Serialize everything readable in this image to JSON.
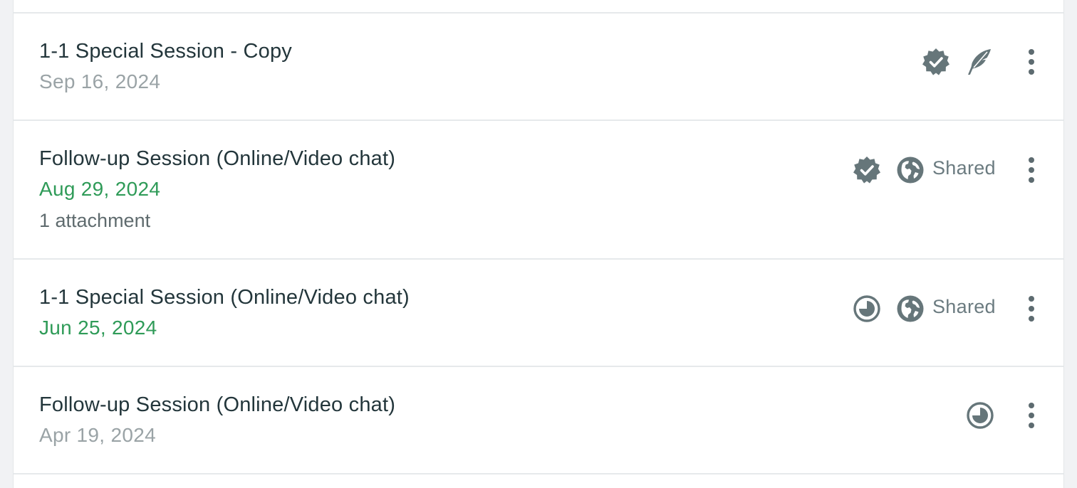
{
  "colors": {
    "title": "#23363b",
    "date_past": "#9aa3a6",
    "date_highlight": "#2f9b58",
    "icon": "#66767a"
  },
  "sessions": [
    {
      "title": "1-1 Special Session - Copy",
      "date": "Sep 16, 2024",
      "status_icon": "verified-badge-icon",
      "extra_icon": "feather-icon",
      "menu_icon": "more-vertical-icon"
    },
    {
      "title": "Follow-up Session (Online/Video chat)",
      "date": "Aug 29, 2024",
      "attachments": "1 attachment",
      "status_icon": "verified-badge-icon",
      "extra_icon": "globe-icon",
      "shared_label": "Shared",
      "menu_icon": "more-vertical-icon"
    },
    {
      "title": "1-1 Special Session (Online/Video chat)",
      "date": "Jun 25, 2024",
      "status_icon": "pending-clock-icon",
      "extra_icon": "globe-icon",
      "shared_label": "Shared",
      "menu_icon": "more-vertical-icon"
    },
    {
      "title": "Follow-up Session (Online/Video chat)",
      "date": "Apr 19, 2024",
      "status_icon": "pending-clock-icon",
      "menu_icon": "more-vertical-icon"
    }
  ]
}
